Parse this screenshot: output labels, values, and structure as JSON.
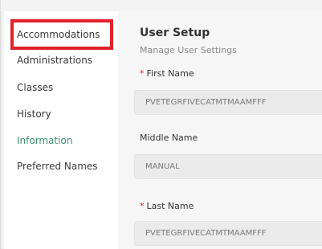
{
  "sidebar": {
    "items": [
      {
        "label": "Accommodations"
      },
      {
        "label": "Administrations"
      },
      {
        "label": "Classes"
      },
      {
        "label": "History"
      },
      {
        "label": "Information"
      },
      {
        "label": "Preferred Names"
      }
    ]
  },
  "main": {
    "title": "User Setup",
    "subtitle": "Manage User Settings",
    "fields": [
      {
        "required_mark": "*",
        "label": "First Name",
        "value": "PVETEGRFIVECATMTMAAMFFF"
      },
      {
        "label": "Middle Name",
        "value": "MANUAL"
      },
      {
        "required_mark": "*",
        "label": "Last Name",
        "value": "PVETEGRFIVECATMTMAAMFFF"
      }
    ]
  },
  "colors": {
    "highlight": "#e3212b",
    "required": "#e3212b",
    "active_link": "#3d8f6b"
  }
}
